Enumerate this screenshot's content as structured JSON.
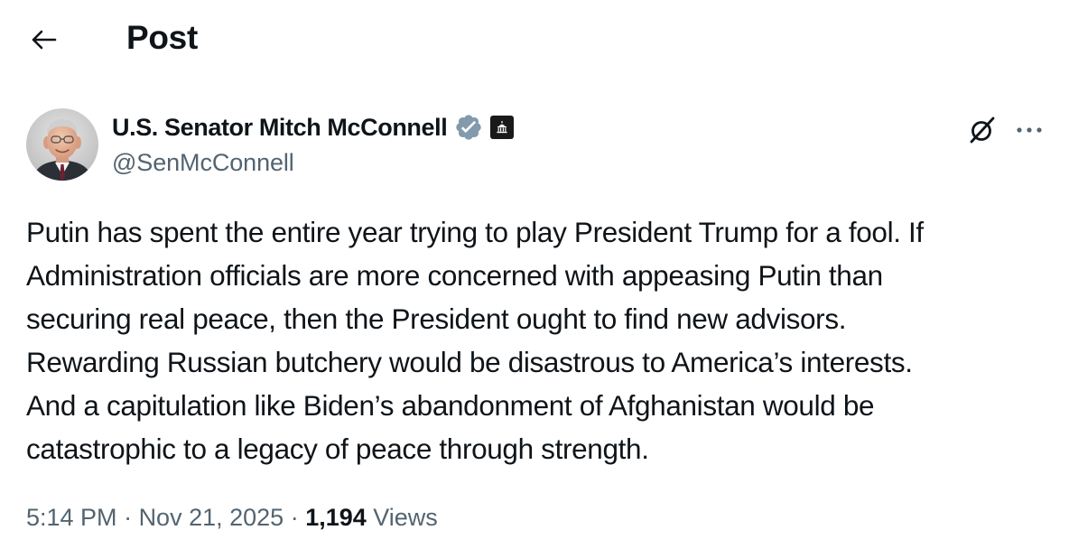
{
  "header": {
    "title": "Post",
    "back_icon": "arrow-left-icon"
  },
  "author": {
    "name": "U.S. Senator Mitch McConnell",
    "handle": "@SenMcConnell",
    "verified_badge_color": "#829aab",
    "affiliation_badge_icon": "capitol-building-icon"
  },
  "actions": {
    "grok_icon": "grok-icon",
    "more_icon": "more-dots-icon"
  },
  "post": {
    "text": "Putin has spent the entire year trying to play President Trump for a fool. If\nAdministration officials are more concerned with appeasing Putin than\nsecuring real peace, then the President ought to find new advisors.\nRewarding Russian butchery would be disastrous to America’s interests.\nAnd a capitulation like Biden’s abandonment of Afghanistan would be\ncatastrophic to a legacy of peace through strength."
  },
  "meta": {
    "time": "5:14 PM",
    "separator": " · ",
    "date": "Nov 21, 2025",
    "views_count": "1,194",
    "views_label": " Views"
  },
  "colors": {
    "text_primary": "#0f1419",
    "text_secondary": "#536471",
    "background": "#ffffff"
  }
}
